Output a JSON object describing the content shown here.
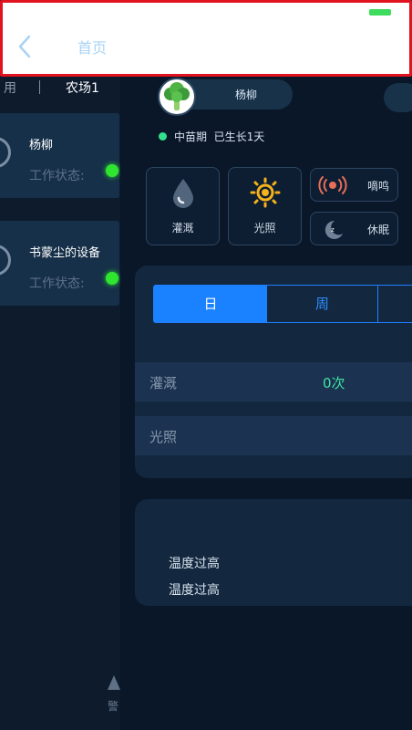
{
  "header": {
    "title": "首页"
  },
  "left_panel": {
    "tab_partial": "用",
    "tab_active": "农场1",
    "devices": [
      {
        "name": "杨柳",
        "status_label": "工作状态:"
      },
      {
        "name": "书蒙尘的设备",
        "status_label": "工作状态:"
      }
    ],
    "bottom_label": "警"
  },
  "plant": {
    "name": "杨柳",
    "stage": "中苗期",
    "grown": "已生长1天"
  },
  "controls": {
    "irrigate": "灌溉",
    "light": "光照",
    "beep": "嘀鸣",
    "sleep": "休眠"
  },
  "stats": {
    "tabs": [
      "日",
      "周"
    ],
    "rows": [
      {
        "label": "灌溉",
        "value": "0次"
      },
      {
        "label": "光照",
        "value": ""
      }
    ]
  },
  "alarms": [
    "温度过高",
    "温度过高"
  ],
  "colors": {
    "accent": "#1a82ff",
    "status_online": "#2fe52f",
    "value_green": "#3fe3a4",
    "header_border": "#e1131f"
  }
}
